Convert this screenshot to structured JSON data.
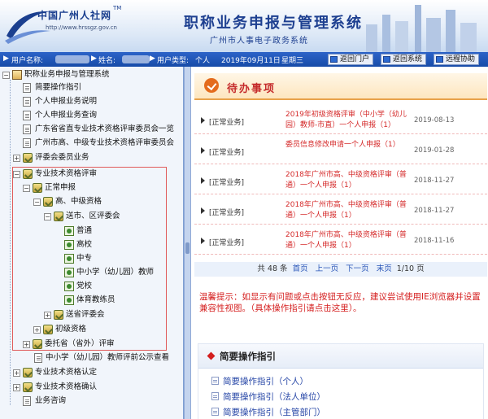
{
  "header": {
    "logo_text": "中国广州人社网",
    "logo_tm": "TM",
    "logo_url": "http://www.hrssgz.gov.cn",
    "system_title": "职称业务申报与管理系统",
    "system_subtitle": "广州市人事电子政务系统"
  },
  "infobar": {
    "username_label": "用户名称:",
    "name_label": "姓名:",
    "usertype_label": "用户类型:",
    "usertype_value": "个人",
    "date": "2019年09月11日",
    "weekday": "星期三",
    "buttons": {
      "back_portal": "返回门户",
      "back_system": "返回系统",
      "remote_help": "远程协助"
    }
  },
  "tree": {
    "root": "职称业务申报与管理系统",
    "n1": "简要操作指引",
    "n2": "个人申报业务说明",
    "n3": "个人申报业务查询",
    "n4": "广东省省直专业技术资格评审委员会一览",
    "n5": "广州市高、中级专业技术资格评审委员会",
    "n6": "评委会委员业务",
    "n7": "专业技术资格评审",
    "n8": "正常申报",
    "n9": "高、中级资格",
    "n10": "送市、区评委会",
    "n11": "普通",
    "n12": "高校",
    "n13": "中专",
    "n14": "中小学（幼儿园）教师",
    "n15": "党校",
    "n16": "体育教练员",
    "n17": "送省评委会",
    "n18": "初级资格",
    "n19": "委托省（省外）评审",
    "n20": "中小学（幼儿园）教师评前公示查看",
    "n21": "专业技术资格认定",
    "n22": "专业技术资格确认",
    "n23": "业务咨询"
  },
  "todo": {
    "title": "待办事项",
    "rows": [
      {
        "category": "[正常业务]",
        "title": "2019年初级资格评审（中小学（幼儿园）教师-市直）一个人申报（1）",
        "date": "2019-08-13"
      },
      {
        "category": "[正常业务]",
        "title": "委员信息修改申请一个人申报（1）",
        "date": "2019-01-28"
      },
      {
        "category": "[正常业务]",
        "title": "2018年广州市高、中级资格评审（普通）一个人申报（1）",
        "date": "2018-11-27"
      },
      {
        "category": "[正常业务]",
        "title": "2018年广州市高、中级资格评审（普通）一个人申报（1）",
        "date": "2018-11-27"
      },
      {
        "category": "[正常业务]",
        "title": "2018年广州市高、中级资格评审（普通）一个人申报（1）",
        "date": "2018-11-16"
      }
    ],
    "pager": {
      "total": "共 48 条",
      "first": "首页",
      "prev": "上一页",
      "next": "下一页",
      "last": "末页",
      "page": "1/10 页"
    }
  },
  "warning": "温馨提示：如显示有问题或点击按钮无反应，建议尝试使用IE浏览器并设置兼容性视图。（具体操作指引请点击这里）。",
  "guide": {
    "title": "简要操作指引",
    "links": [
      "简要操作指引（个人）",
      "简要操作指引（法人单位）",
      "简要操作指引（主管部门）"
    ]
  },
  "colors": {
    "brand_blue": "#1d3f90",
    "infobar": "#2c63c8",
    "alert_red": "#d51f1f"
  }
}
